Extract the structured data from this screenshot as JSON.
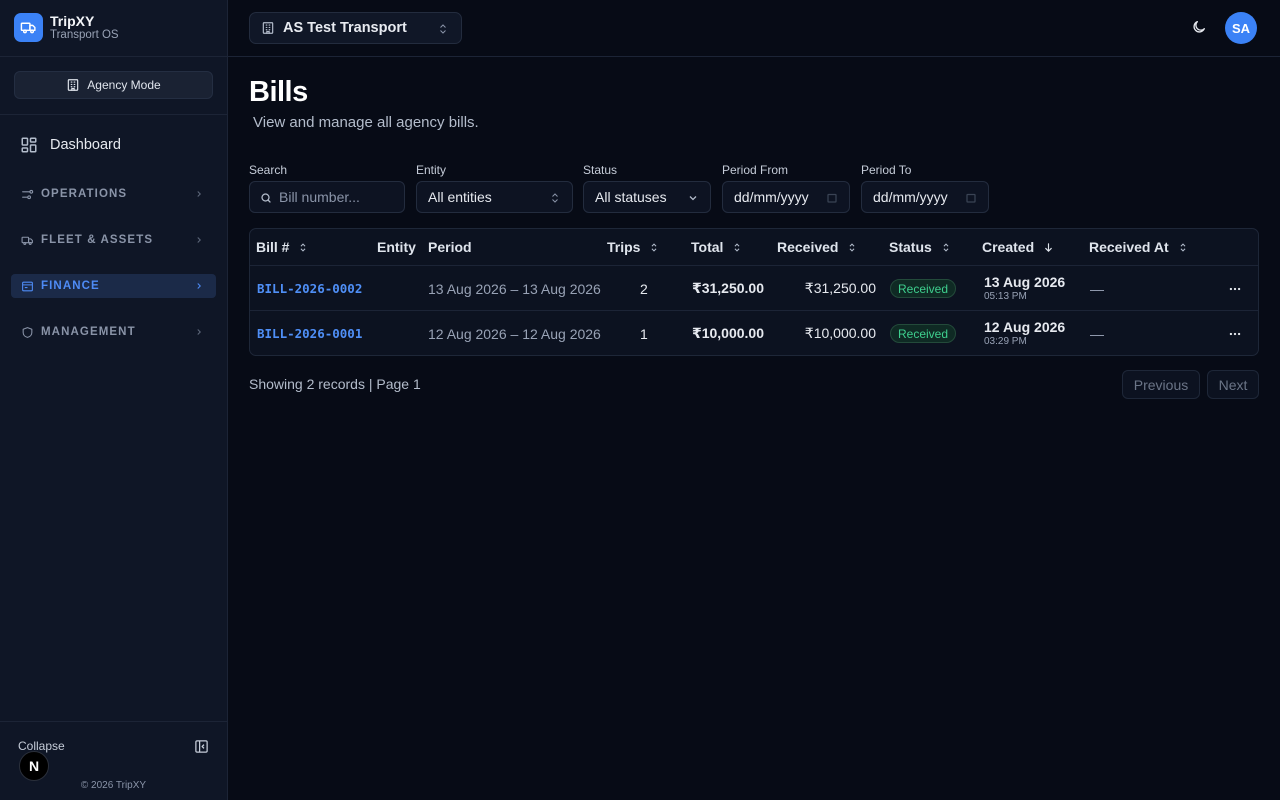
{
  "brand": {
    "name": "TripXY",
    "subtitle": "Transport OS"
  },
  "sidebar": {
    "mode_label": "Agency Mode",
    "dashboard_label": "Dashboard",
    "groups": [
      {
        "label": "OPERATIONS",
        "active": false
      },
      {
        "label": "FLEET & ASSETS",
        "active": false
      },
      {
        "label": "FINANCE",
        "active": true
      },
      {
        "label": "MANAGEMENT",
        "active": false
      }
    ],
    "collapse_label": "Collapse",
    "avatar_letter": "N",
    "copyright": "© 2026 TripXY"
  },
  "topbar": {
    "org_name": "AS Test Transport",
    "user_initials": "SA"
  },
  "page": {
    "title": "Bills",
    "subtitle": "View and manage all agency bills."
  },
  "filters": {
    "search": {
      "label": "Search",
      "placeholder": "Bill number..."
    },
    "entity": {
      "label": "Entity",
      "value": "All entities"
    },
    "status": {
      "label": "Status",
      "value": "All statuses"
    },
    "period_from": {
      "label": "Period From",
      "value": "dd/mm/yyyy"
    },
    "period_to": {
      "label": "Period To",
      "value": "dd/mm/yyyy"
    }
  },
  "table": {
    "headers": [
      "Bill #",
      "Entity",
      "Period",
      "Trips",
      "Total",
      "Received",
      "Status",
      "Created",
      "Received At"
    ],
    "rows": [
      {
        "bill": "BILL-2026-0002",
        "entity": "",
        "period": "13 Aug 2026 – 13 Aug 2026",
        "trips": "2",
        "total": "₹31,250.00",
        "received": "₹31,250.00",
        "status": "Received",
        "created_date": "13 Aug 2026",
        "created_time": "05:13 PM",
        "received_at": "—"
      },
      {
        "bill": "BILL-2026-0001",
        "entity": "",
        "period": "12 Aug 2026 – 12 Aug 2026",
        "trips": "1",
        "total": "₹10,000.00",
        "received": "₹10,000.00",
        "status": "Received",
        "created_date": "12 Aug 2026",
        "created_time": "03:29 PM",
        "received_at": "—"
      }
    ]
  },
  "pagination": {
    "info": "Showing 2 records | Page 1",
    "previous": "Previous",
    "next": "Next"
  },
  "colors": {
    "accent": "#3b82f6",
    "status_received": "#3ecf8e",
    "background": "#070b16",
    "sidebar": "#0f1626"
  }
}
